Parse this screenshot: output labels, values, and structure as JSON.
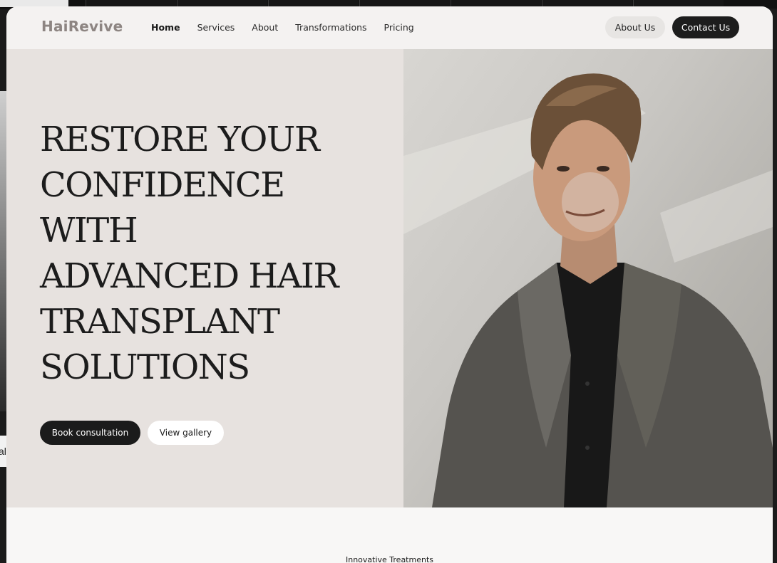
{
  "brand": {
    "name": "HaiRevive"
  },
  "nav": {
    "links": [
      {
        "label": "Home",
        "active": true
      },
      {
        "label": "Services"
      },
      {
        "label": "About"
      },
      {
        "label": "Transformations"
      },
      {
        "label": "Pricing"
      }
    ],
    "about_button": "About Us",
    "contact_button": "Contact Us"
  },
  "hero": {
    "title_lines": [
      "RESTORE YOUR",
      "CONFIDENCE",
      "WITH",
      "ADVANCED HAIR",
      "TRANSPLANT",
      "SOLUTIONS"
    ],
    "primary_button": "Book consultation",
    "secondary_button": "View gallery",
    "image_icon": "portrait-photo"
  },
  "next_section": {
    "label": "Innovative Treatments"
  },
  "background": {
    "edge_text": "al"
  },
  "colors": {
    "accent_dark": "#1d1d1d",
    "hero_bg": "#e7e2df",
    "logo": "#8d8582"
  }
}
